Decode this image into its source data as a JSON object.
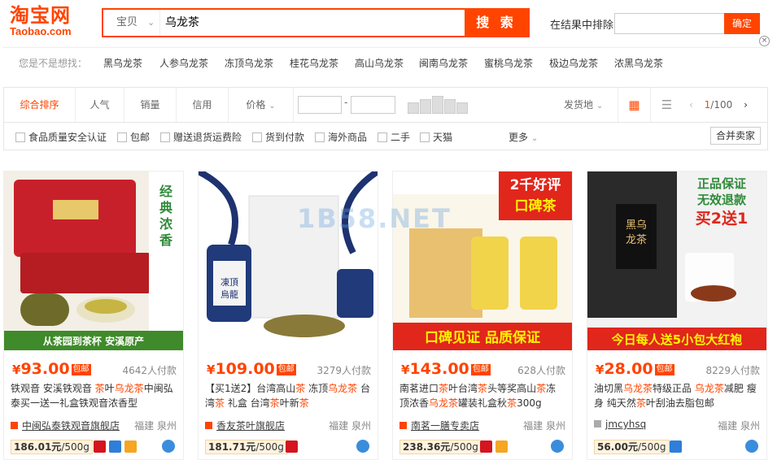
{
  "header": {
    "logo_cn": "淘宝网",
    "logo_en": "Taobao.com",
    "search_type": "宝贝",
    "search_value": "乌龙茶",
    "search_button": "搜 索",
    "filter_label": "在结果中排除",
    "filter_button": "确定"
  },
  "suggestions": {
    "label": "您是不是想找：",
    "items": [
      "黑乌龙茶",
      "人参乌龙茶",
      "冻顶乌龙茶",
      "桂花乌龙茶",
      "高山乌龙茶",
      "闽南乌龙茶",
      "蜜桃乌龙茶",
      "极边乌龙茶",
      "浓黑乌龙茶"
    ]
  },
  "sortbar": {
    "tabs": [
      "综合排序",
      "人气",
      "销量",
      "信用",
      "价格"
    ],
    "price_dash": "-",
    "ship_from": "发货地",
    "page_current": "1",
    "page_total": "/100"
  },
  "filters": {
    "items": [
      "食品质量安全认证",
      "包邮",
      "赠送退货运费险",
      "货到付款",
      "海外商品",
      "二手",
      "天猫"
    ],
    "more": "更多",
    "merge": "合并卖家"
  },
  "watermark": "1B58.NET",
  "products": [
    {
      "price_symbol": "¥",
      "price": "93.00",
      "free_ship": "包邮",
      "sold": "4642人付款",
      "title_parts": [
        "铁观音 安溪铁观音 ",
        "茶",
        "叶",
        "乌龙茶",
        "中闽弘泰买一送一礼盒铁观音浓香型"
      ],
      "shop": "中闽弘泰铁观音旗舰店",
      "location": "福建 泉州",
      "unit_price": "186.01元",
      "unit_suffix": "/500g",
      "img_text_top": "经典浓香",
      "img_text_bottom": "从茶园到茶杯 安溪原产"
    },
    {
      "price_symbol": "¥",
      "price": "109.00",
      "free_ship": "包邮",
      "sold": "3279人付款",
      "title_parts": [
        "【买1送2】台湾高山",
        "茶",
        " 冻顶",
        "乌龙茶",
        " 台湾",
        "茶",
        " 礼盒 台湾",
        "茶",
        "叶新",
        "茶"
      ],
      "shop": "香友茶叶旗舰店",
      "location": "福建 泉州",
      "unit_price": "181.71元",
      "unit_suffix": "/500g",
      "img_text_top": "凍頂烏龍",
      "img_text_bottom": ""
    },
    {
      "price_symbol": "¥",
      "price": "143.00",
      "free_ship": "包邮",
      "sold": "628人付款",
      "title_parts": [
        "南茗进口",
        "茶",
        "叶台湾",
        "茶",
        "头等奖高山",
        "茶",
        "冻顶浓香",
        "乌龙茶",
        "罐装礼盒秋",
        "茶",
        "300g"
      ],
      "shop": "南茗一膳专卖店",
      "location": "福建 泉州",
      "unit_price": "238.36元",
      "unit_suffix": "/500g",
      "img_text_top": "2千好评 口碑茶",
      "img_text_bottom": "口碑见证 品质保证"
    },
    {
      "price_symbol": "¥",
      "price": "28.00",
      "free_ship": "包邮",
      "sold": "8229人付款",
      "title_parts": [
        "油切黑",
        "乌龙茶",
        "特级正品 ",
        "乌龙茶",
        "减肥 瘦身 纯天然",
        "茶",
        "叶刮油去脂包邮"
      ],
      "shop": "jmcyhsq",
      "location": "福建 泉州",
      "unit_price": "56.00元",
      "unit_suffix": "/500g",
      "img_text_top": "正品保证 无效退款 买2送1",
      "img_text_bottom": "今日每人送5小包大红袍"
    }
  ]
}
